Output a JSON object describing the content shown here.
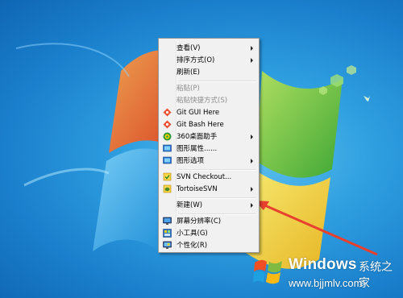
{
  "context_menu": {
    "items": [
      {
        "label": "查看(V)",
        "submenu": true,
        "disabled": false,
        "icon": ""
      },
      {
        "label": "排序方式(O)",
        "submenu": true,
        "disabled": false,
        "icon": ""
      },
      {
        "label": "刷新(E)",
        "submenu": false,
        "disabled": false,
        "icon": ""
      },
      {
        "label": "粘贴(P)",
        "submenu": false,
        "disabled": true,
        "icon": ""
      },
      {
        "label": "粘贴快捷方式(S)",
        "submenu": false,
        "disabled": true,
        "icon": ""
      },
      {
        "label": "Git GUI Here",
        "submenu": false,
        "disabled": false,
        "icon": "git-gui-icon"
      },
      {
        "label": "Git Bash Here",
        "submenu": false,
        "disabled": false,
        "icon": "git-bash-icon"
      },
      {
        "label": "360桌面助手",
        "submenu": true,
        "disabled": false,
        "icon": "360-icon"
      },
      {
        "label": "图形属性......",
        "submenu": false,
        "disabled": false,
        "icon": "graphics-properties-icon"
      },
      {
        "label": "图形选项",
        "submenu": true,
        "disabled": false,
        "icon": "graphics-options-icon"
      },
      {
        "label": "SVN Checkout...",
        "submenu": false,
        "disabled": false,
        "icon": "svn-checkout-icon"
      },
      {
        "label": "TortoiseSVN",
        "submenu": true,
        "disabled": false,
        "icon": "tortoisesvn-icon"
      },
      {
        "label": "新建(W)",
        "submenu": true,
        "disabled": false,
        "icon": ""
      },
      {
        "label": "屏幕分辨率(C)",
        "submenu": false,
        "disabled": false,
        "icon": "screen-resolution-icon"
      },
      {
        "label": "小工具(G)",
        "submenu": false,
        "disabled": false,
        "icon": "gadgets-icon"
      },
      {
        "label": "个性化(R)",
        "submenu": false,
        "disabled": false,
        "icon": "personalize-icon"
      }
    ]
  },
  "watermark": {
    "title": "Windows",
    "subtitle": "系统之家",
    "url": "www.bjjmlv.com"
  },
  "colors": {
    "desktop_blue": "#2f9fe0",
    "annotation_arrow": "#e8402f"
  }
}
